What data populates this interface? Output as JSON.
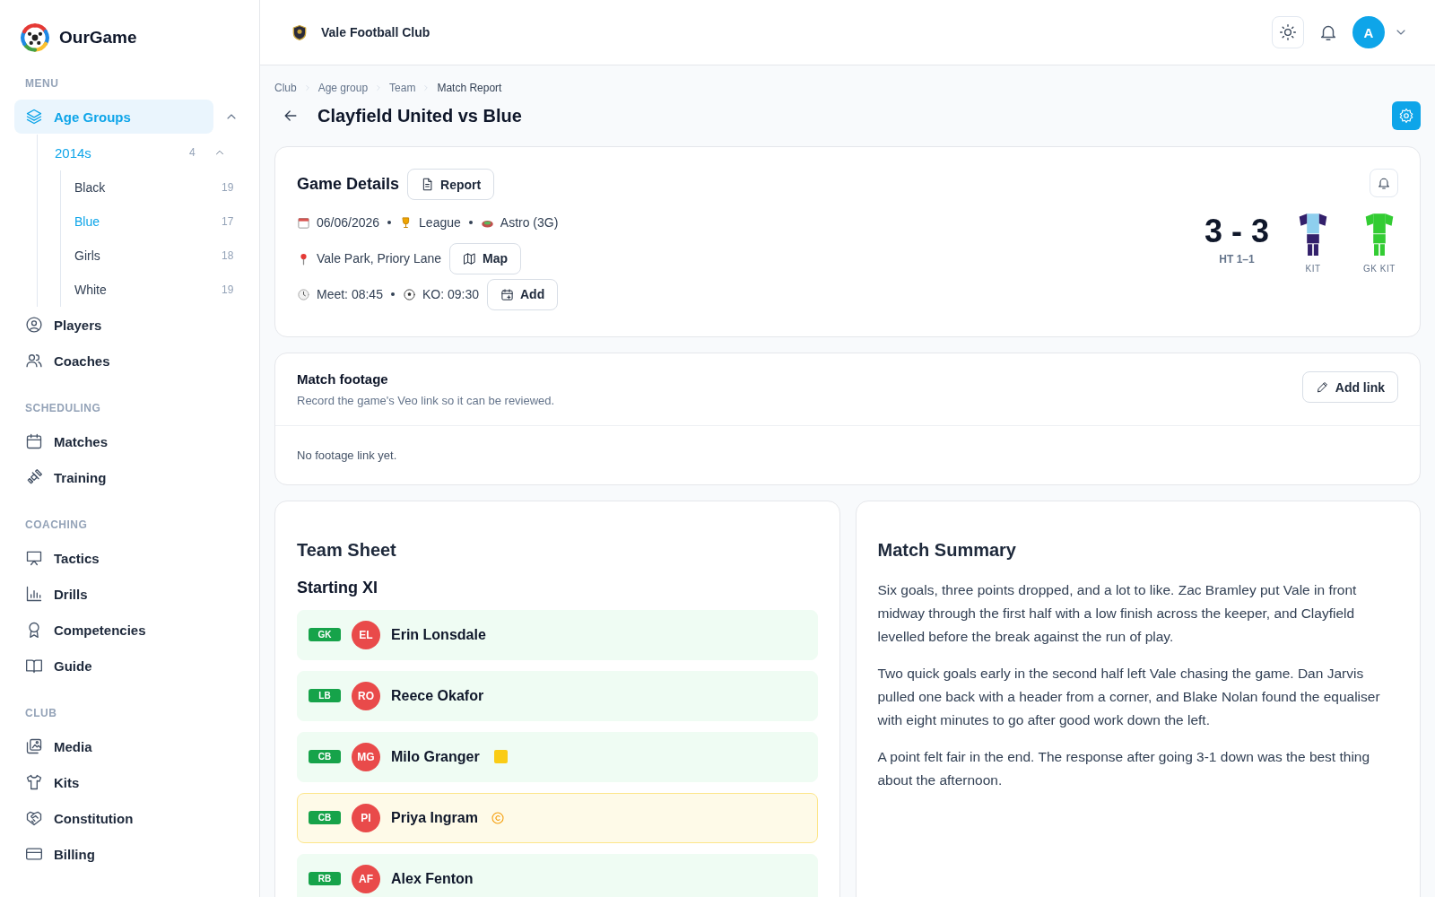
{
  "sidebar": {
    "app_name": "OurGame",
    "sections": [
      {
        "heading": "MENU",
        "items": [
          {
            "label": "Age Groups",
            "selected": true,
            "expanded": true,
            "children": [
              {
                "label": "2014s",
                "count": "4",
                "selected": true,
                "expanded": true,
                "children": [
                  {
                    "label": "Black",
                    "count": "19",
                    "selected": false
                  },
                  {
                    "label": "Blue",
                    "count": "17",
                    "selected": true
                  },
                  {
                    "label": "Girls",
                    "count": "18",
                    "selected": false
                  },
                  {
                    "label": "White",
                    "count": "19",
                    "selected": false
                  }
                ]
              }
            ]
          },
          {
            "label": "Players",
            "selected": false
          },
          {
            "label": "Coaches",
            "selected": false
          }
        ]
      },
      {
        "heading": "SCHEDULING",
        "items": [
          {
            "label": "Matches",
            "selected": false
          },
          {
            "label": "Training",
            "selected": false
          }
        ]
      },
      {
        "heading": "COACHING",
        "items": [
          {
            "label": "Tactics",
            "selected": false
          },
          {
            "label": "Drills",
            "selected": false
          },
          {
            "label": "Competencies",
            "selected": false
          },
          {
            "label": "Guide",
            "selected": false
          }
        ]
      },
      {
        "heading": "CLUB",
        "items": [
          {
            "label": "Media",
            "selected": false
          },
          {
            "label": "Kits",
            "selected": false
          },
          {
            "label": "Constitution",
            "selected": false
          },
          {
            "label": "Billing",
            "selected": false
          }
        ]
      }
    ]
  },
  "header": {
    "club_name": "Vale Football Club",
    "avatar_initial": "A"
  },
  "breadcrumb": [
    "Club",
    "Age group",
    "Team",
    "Match Report"
  ],
  "page_title": "Clayfield United vs Blue",
  "game_details": {
    "title": "Game Details",
    "report_button": "Report",
    "date": "06/06/2026",
    "competition": "League",
    "surface": "Astro (3G)",
    "location": "Vale Park, Priory Lane",
    "map_button": "Map",
    "meet": "Meet: 08:45",
    "kickoff": "KO: 09:30",
    "add_button": "Add",
    "score": "3 - 3",
    "half_time": "HT 1–1",
    "kits": [
      {
        "label": "KIT",
        "shirt": {
          "color": "#8ecfee"
        },
        "trim": {
          "color": "#33206b"
        }
      },
      {
        "label": "GK KIT",
        "shirt": {
          "color": "#33cc33"
        },
        "trim": {
          "color": "#33cc33"
        }
      }
    ]
  },
  "footage": {
    "title": "Match footage",
    "description": "Record the game's Veo link so it can be reviewed.",
    "button": "Add link",
    "empty_text": "No footage link yet."
  },
  "team_sheet": {
    "title": "Team Sheet",
    "subtitle": "Starting XI",
    "players": [
      {
        "position": "GK",
        "initials": "EL",
        "name": "Erin Lonsdale",
        "yellow_card": false,
        "captain": false
      },
      {
        "position": "LB",
        "initials": "RO",
        "name": "Reece Okafor",
        "yellow_card": false,
        "captain": false
      },
      {
        "position": "CB",
        "initials": "MG",
        "name": "Milo Granger",
        "yellow_card": true,
        "captain": false
      },
      {
        "position": "CB",
        "initials": "PI",
        "name": "Priya Ingram",
        "yellow_card": false,
        "captain": true
      },
      {
        "position": "RB",
        "initials": "AF",
        "name": "Alex Fenton",
        "yellow_card": false,
        "captain": false
      }
    ]
  },
  "summary": {
    "title": "Match Summary",
    "paragraphs": [
      "Six goals, three points dropped, and a lot to like. Zac Bramley put Vale in front midway through the first half with a low finish across the keeper, and Clayfield levelled before the break against the run of play.",
      "Two quick goals early in the second half left Vale chasing the game. Dan Jarvis pulled one back with a header from a corner, and Blake Nolan found the equaliser with eight minutes to go after good work down the left.",
      "A point felt fair in the end. The response after going 3-1 down was the best thing about the afternoon."
    ]
  }
}
